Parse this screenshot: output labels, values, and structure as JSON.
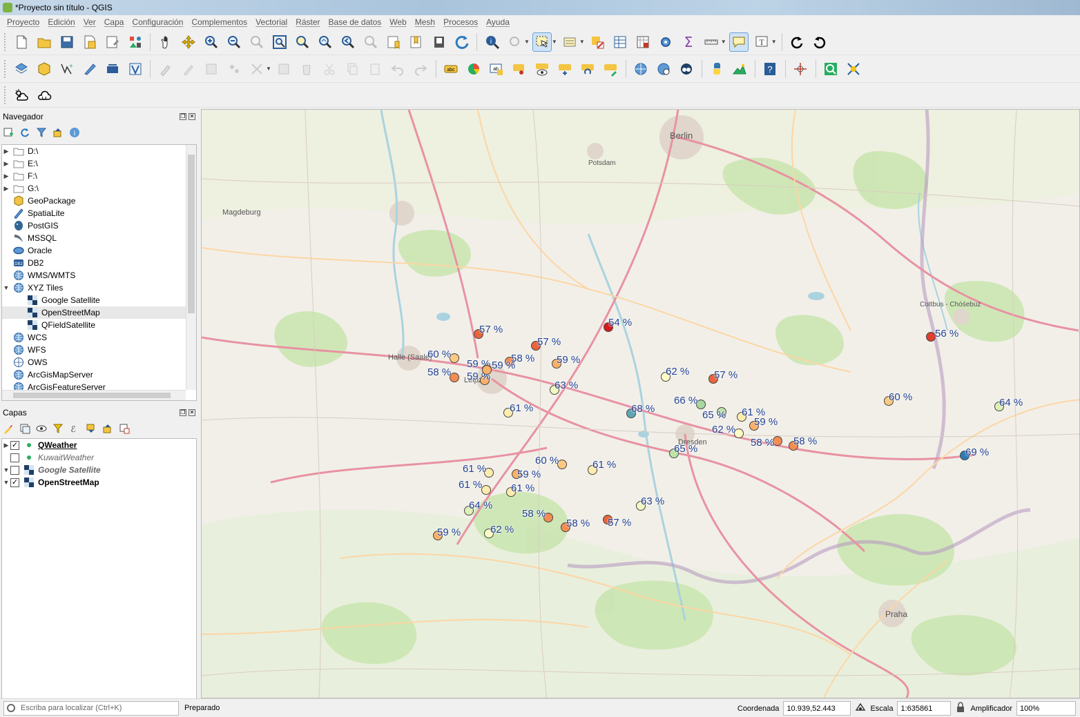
{
  "window": {
    "title": "*Proyecto sin título - QGIS"
  },
  "menu": [
    "Proyecto",
    "Edición",
    "Ver",
    "Capa",
    "Configuración",
    "Complementos",
    "Vectorial",
    "Ráster",
    "Base de datos",
    "Web",
    "Mesh",
    "Procesos",
    "Ayuda"
  ],
  "navigator": {
    "title": "Navegador",
    "items": [
      {
        "label": "D:\\",
        "icon": "folder-icon",
        "expander": "▶"
      },
      {
        "label": "E:\\",
        "icon": "folder-icon",
        "expander": "▶"
      },
      {
        "label": "F:\\",
        "icon": "folder-icon",
        "expander": "▶"
      },
      {
        "label": "G:\\",
        "icon": "folder-icon",
        "expander": "▶"
      },
      {
        "label": "GeoPackage",
        "icon": "geopackage-icon",
        "expander": ""
      },
      {
        "label": "SpatiaLite",
        "icon": "spatialite-icon",
        "expander": ""
      },
      {
        "label": "PostGIS",
        "icon": "postgis-icon",
        "expander": ""
      },
      {
        "label": "MSSQL",
        "icon": "mssql-icon",
        "expander": ""
      },
      {
        "label": "Oracle",
        "icon": "oracle-icon",
        "expander": ""
      },
      {
        "label": "DB2",
        "icon": "db2-icon",
        "expander": ""
      },
      {
        "label": "WMS/WMTS",
        "icon": "globe-icon",
        "expander": ""
      },
      {
        "label": "XYZ Tiles",
        "icon": "globe-icon",
        "expander": "▼"
      },
      {
        "label": "Google Satellite",
        "icon": "tiles-icon",
        "expander": "",
        "indent": true
      },
      {
        "label": "OpenStreetMap",
        "icon": "tiles-icon",
        "expander": "",
        "indent": true,
        "selected": true
      },
      {
        "label": "QFieldSatellite",
        "icon": "tiles-icon",
        "expander": "",
        "indent": true
      },
      {
        "label": "WCS",
        "icon": "globe-icon",
        "expander": ""
      },
      {
        "label": "WFS",
        "icon": "globe-icon",
        "expander": ""
      },
      {
        "label": "OWS",
        "icon": "globe-outline-icon",
        "expander": ""
      },
      {
        "label": "ArcGisMapServer",
        "icon": "globe-icon",
        "expander": ""
      },
      {
        "label": "ArcGisFeatureServer",
        "icon": "globe-icon",
        "expander": ""
      }
    ]
  },
  "layers": {
    "title": "Capas",
    "items": [
      {
        "label": "QWeather",
        "checked": true,
        "style": "bold-underline",
        "expander": "▶",
        "icon": "point-layer-icon"
      },
      {
        "label": "KuwaitWeather",
        "checked": false,
        "style": "italic",
        "expander": "",
        "icon": "point-layer-icon"
      },
      {
        "label": "Google Satellite",
        "checked": false,
        "style": "italic-bold",
        "expander": "▼",
        "icon": "raster-layer-icon"
      },
      {
        "label": "OpenStreetMap",
        "checked": true,
        "style": "bold",
        "expander": "▼",
        "icon": "raster-layer-icon"
      }
    ]
  },
  "markers": [
    {
      "label": "57 %",
      "color": "#e8643c"
    },
    {
      "label": "54 %",
      "color": "#d7191c"
    },
    {
      "label": "57 %",
      "color": "#e8643c"
    },
    {
      "label": "56 %",
      "color": "#de3f2e"
    },
    {
      "label": "60 %",
      "color": "#fdc980"
    },
    {
      "label": "59 %",
      "color": "#fbb068"
    },
    {
      "label": "58 %",
      "color": "#f58c51"
    },
    {
      "label": "59 %",
      "color": "#fbb068"
    },
    {
      "label": "58 %",
      "color": "#f58c51"
    },
    {
      "label": "59 %",
      "color": "#fbb068"
    },
    {
      "label": "59 %",
      "color": "#fbb068"
    },
    {
      "label": "62 %",
      "color": "#fffcc6"
    },
    {
      "label": "57 %",
      "color": "#e8643c"
    },
    {
      "label": "63 %",
      "color": "#f2f8c2"
    },
    {
      "label": "61 %",
      "color": "#feecae"
    },
    {
      "label": "66 %",
      "color": "#a8d8a0"
    },
    {
      "label": "68 %",
      "color": "#5fa6b6"
    },
    {
      "label": "65 %",
      "color": "#bfe3a6"
    },
    {
      "label": "60 %",
      "color": "#fdc980"
    },
    {
      "label": "64 %",
      "color": "#def0b4"
    },
    {
      "label": "62 %",
      "color": "#fffcc6"
    },
    {
      "label": "59 %",
      "color": "#fbb068"
    },
    {
      "label": "61 %",
      "color": "#feecae"
    },
    {
      "label": "58 %",
      "color": "#f58c51"
    },
    {
      "label": "58 %",
      "color": "#f58c51"
    },
    {
      "label": "65 %",
      "color": "#bfe3a6"
    },
    {
      "label": "69 %",
      "color": "#2c7bb6"
    },
    {
      "label": "60 %",
      "color": "#fdc980"
    },
    {
      "label": "61 %",
      "color": "#feecae"
    },
    {
      "label": "61 %",
      "color": "#feecae"
    },
    {
      "label": "59 %",
      "color": "#fbb068"
    },
    {
      "label": "61 %",
      "color": "#feecae"
    },
    {
      "label": "61 %",
      "color": "#feecae"
    },
    {
      "label": "64 %",
      "color": "#def0b4"
    },
    {
      "label": "58 %",
      "color": "#f58c51"
    },
    {
      "label": "58 %",
      "color": "#f58c51"
    },
    {
      "label": "57 %",
      "color": "#e8643c"
    },
    {
      "label": "63 %",
      "color": "#f2f8c2"
    },
    {
      "label": "59 %",
      "color": "#fbb068"
    },
    {
      "label": "62 %",
      "color": "#fffcc6"
    }
  ],
  "map_places": [
    "Berlin",
    "Magdeburg",
    "Halle (Saale)",
    "Cottbus - Chóśebuz",
    "Praha",
    "Potsdam",
    "Leipzig",
    "Dresden"
  ],
  "statusbar": {
    "locator_placeholder": "Escriba para localizar (Ctrl+K)",
    "message": "Preparado",
    "coord_label": "Coordenada",
    "coord_value": "10.939,52.443",
    "scale_label": "Escala",
    "scale_value": "1:635861",
    "magnifier_label": "Amplificador",
    "magnifier_value": "100%"
  }
}
